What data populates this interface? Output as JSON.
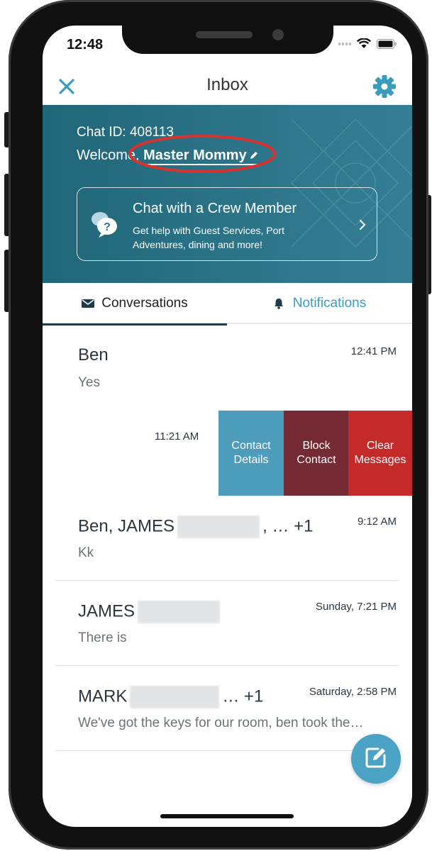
{
  "status": {
    "time": "12:48"
  },
  "header": {
    "title": "Inbox"
  },
  "hero": {
    "chat_id": "Chat ID: 408113",
    "welcome_prefix": "Welcome,",
    "user_name": "Master Mommy",
    "crew_card": {
      "title": "Chat with a Crew Member",
      "subtitle": "Get help with Guest Services, Port Adventures, dining and more!"
    }
  },
  "tabs": [
    {
      "label": "Conversations",
      "active": true
    },
    {
      "label": "Notifications",
      "active": false
    }
  ],
  "conversations": [
    {
      "name": "Ben",
      "preview": "Yes",
      "time": "12:41 PM"
    },
    {
      "name": "",
      "preview": "",
      "time": "11:21 AM"
    },
    {
      "name": "Ben, JAMES",
      "name_suffix": ", … +1",
      "preview": "Kk",
      "time": "9:12 AM"
    },
    {
      "name": "JAMES",
      "name_suffix": "",
      "preview": "There is",
      "time": "Sunday, 7:21 PM"
    },
    {
      "name": "MARK",
      "name_suffix": "… +1",
      "preview": "We've got the keys for our room, ben took the…",
      "time": "Saturday, 2:58 PM"
    }
  ],
  "swipe_actions": {
    "contact_details": "Contact Details",
    "block_contact": "Block Contact",
    "clear_messages": "Clear Messages"
  },
  "colors": {
    "accent": "#3a9bbd",
    "hero": "#2b7387",
    "contact_action": "#4e9cbc",
    "block_action": "#762a33",
    "clear_action": "#c42a2a",
    "annotation": "#d8322f"
  }
}
